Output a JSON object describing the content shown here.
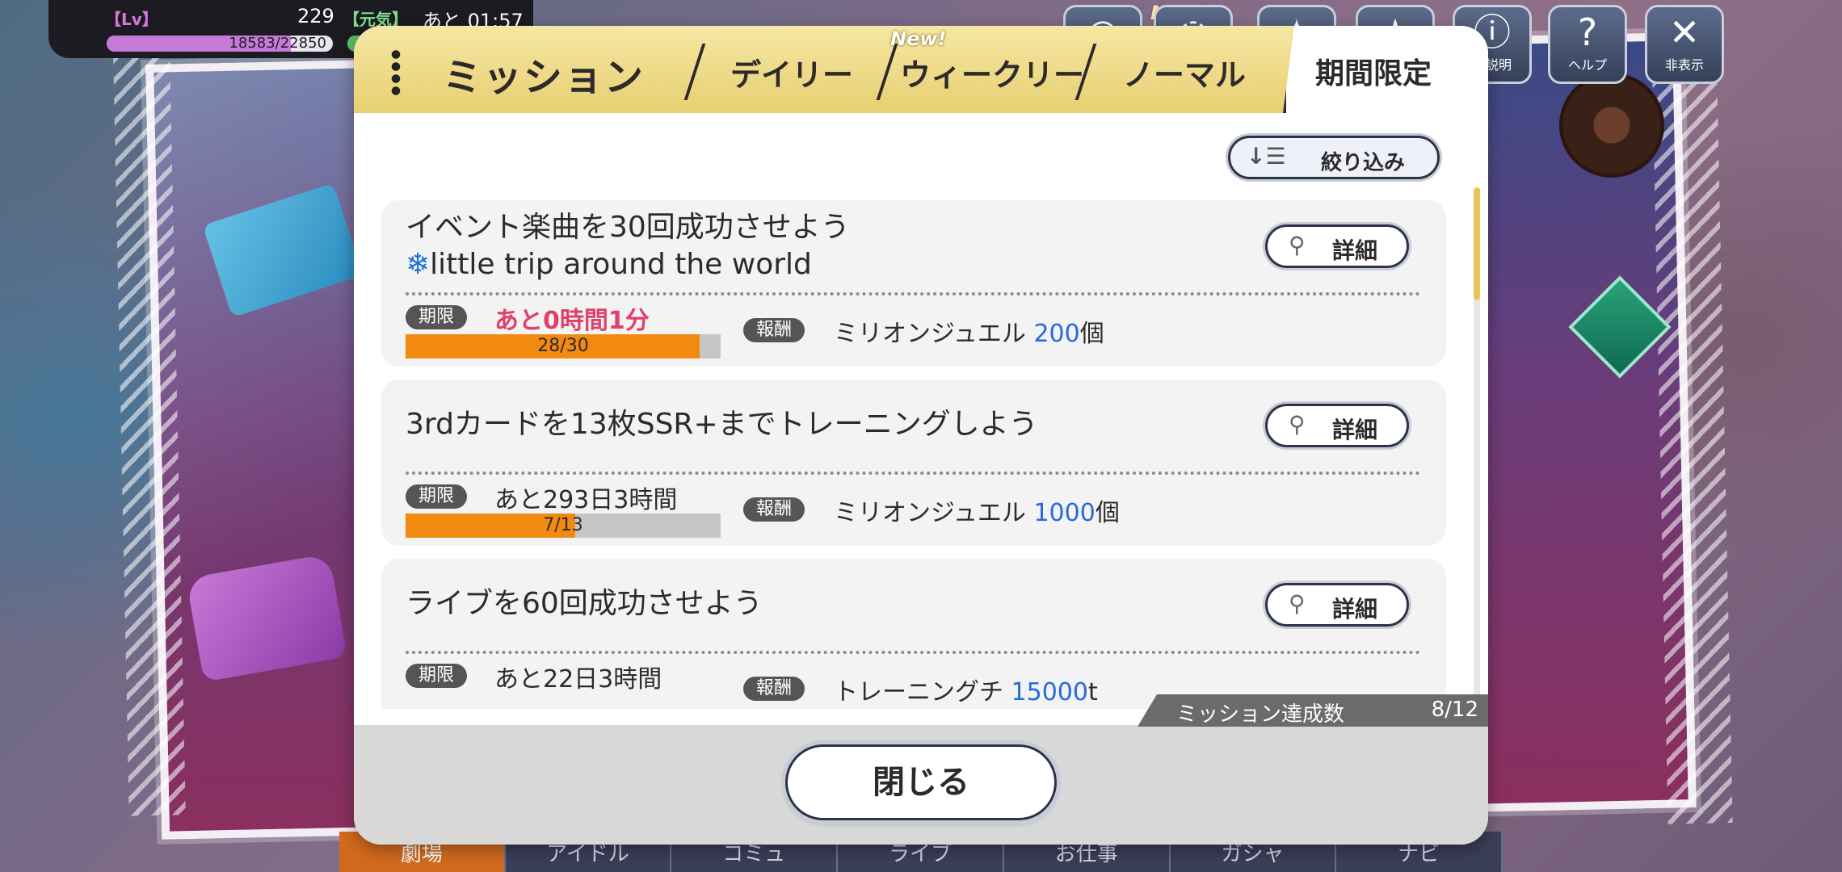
{
  "status": {
    "lv_label": "【Lv】",
    "level": "229",
    "genki_label": "【元気】",
    "time_left": "あと 01:57",
    "exp_text": "18583/22850",
    "exp_fraction": 0.813
  },
  "top_buttons": {
    "new_badge": "New!",
    "info_label": "ル説明",
    "help_label": "ヘルプ",
    "hide_label": "非表示"
  },
  "bottom_nav": [
    "劇場",
    "アイドル",
    "コミュ",
    "ライブ",
    "お仕事",
    "ガシャ",
    "ナビ"
  ],
  "dialog": {
    "title": "ミッション",
    "tabs": [
      "デイリー",
      "ウィークリー",
      "ノーマル",
      "期間限定"
    ],
    "tab_new_badge": "New!",
    "active_tab": "期間限定",
    "filter_label": "絞り込み",
    "detail_label": "詳細",
    "deadline_pill": "期限",
    "reward_pill": "報酬",
    "missions": [
      {
        "title_line1": "イベント楽曲を30回成功させよう",
        "title_line2": "little trip around the world",
        "deadline": "あと0時間1分",
        "progress_text": "28/30",
        "progress": 0.933,
        "reward_name": "ミリオンジュエル",
        "reward_amount": "200",
        "reward_unit": "個"
      },
      {
        "title_line1": "3rdカードを13枚SSR+までトレーニングしよう",
        "deadline": "あと293日3時間",
        "progress_text": "7/13",
        "progress": 0.538,
        "reward_name": "ミリオンジュエル",
        "reward_amount": "1000",
        "reward_unit": "個"
      },
      {
        "title_line1": "ライブを60回成功させよう",
        "deadline": "あと22日3時間",
        "reward_name": "トレーニングチ",
        "reward_amount": "15000",
        "reward_unit": "t"
      }
    ],
    "achievement_label": "ミッション達成数",
    "achievement_count": "8/12",
    "close_label": "閉じる"
  }
}
